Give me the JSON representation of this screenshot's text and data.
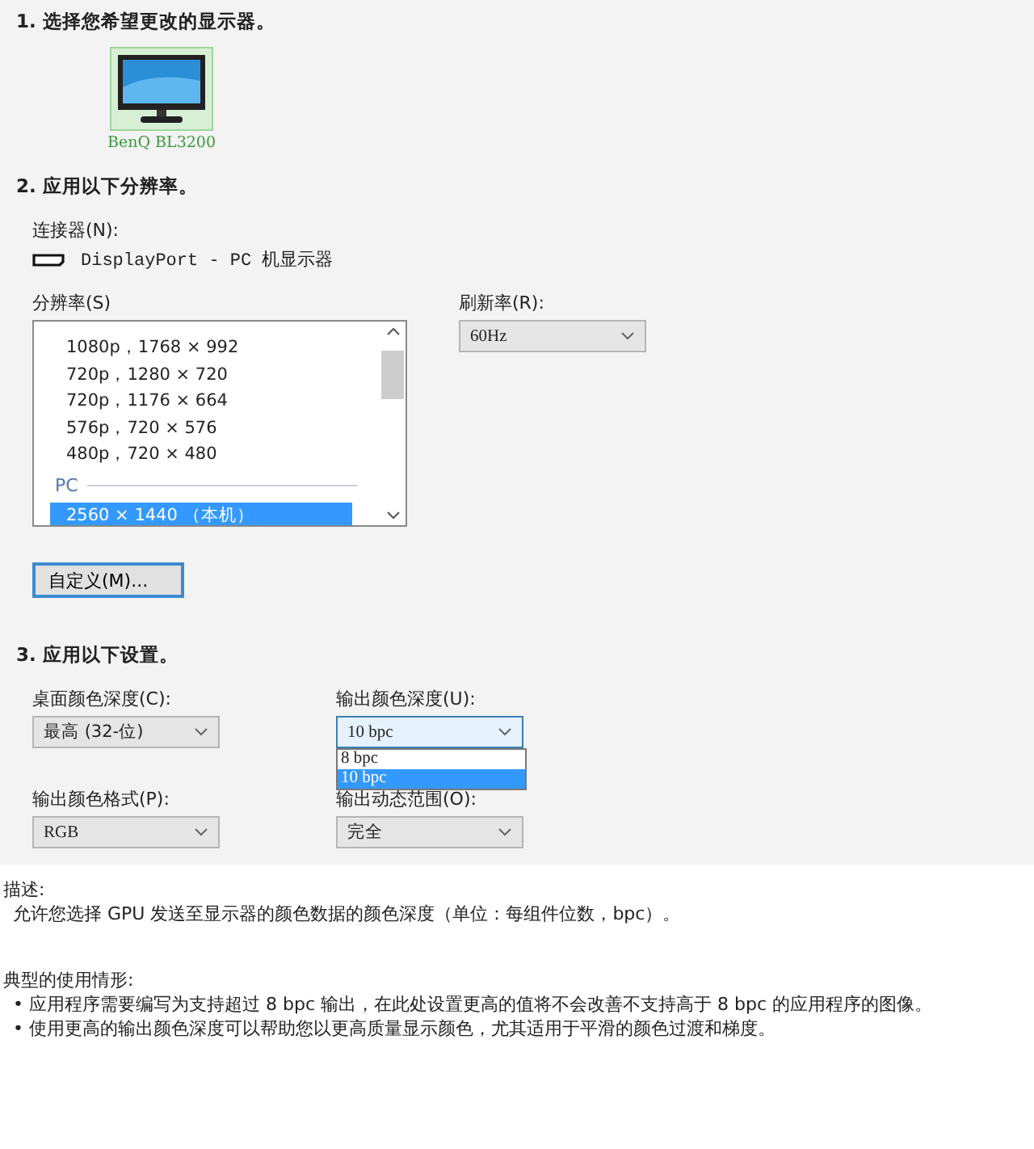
{
  "section_1": {
    "title": "1. 选择您希望更改的显示器。",
    "monitors": [
      {
        "name": "BenQ BL3200",
        "selected": true
      }
    ]
  },
  "section_2": {
    "title": "2. 应用以下分辨率。",
    "connector_label": "连接器(N):",
    "connector": "DisplayPort - PC 机显示器",
    "resolution_label": "分辨率(S)",
    "resolutions": [
      {
        "kind": "item",
        "label": "1080p，1768 × 992",
        "selected": false
      },
      {
        "kind": "item",
        "label": "720p，1280 × 720",
        "selected": false
      },
      {
        "kind": "item",
        "label": "720p，1176 × 664",
        "selected": false
      },
      {
        "kind": "item",
        "label": "576p，720 × 576",
        "selected": false
      },
      {
        "kind": "item",
        "label": "480p，720 × 480",
        "selected": false
      },
      {
        "kind": "header",
        "label": "PC"
      },
      {
        "kind": "item",
        "label": "2560 × 1440 （本机）",
        "selected": true
      }
    ],
    "refresh_label": "刷新率(R):",
    "refresh_value": "60Hz",
    "custom_button": "自定义(M)..."
  },
  "section_3": {
    "title": "3. 应用以下设置。",
    "fields": [
      {
        "label": "桌面颜色深度(C):",
        "value": "最高 (32-位)",
        "expanded": false
      },
      {
        "label": "输出颜色深度(U):",
        "value": "10 bpc",
        "expanded": true,
        "options": [
          {
            "label": "8 bpc",
            "selected": false
          },
          {
            "label": "10 bpc",
            "selected": true
          }
        ]
      },
      {
        "label": "输出颜色格式(P):",
        "value": "RGB",
        "expanded": false
      },
      {
        "label": "输出动态范围(O):",
        "value": "完全",
        "expanded": false
      }
    ]
  },
  "description": {
    "label": "描述:",
    "text": "允许您选择 GPU 发送至显示器的颜色数据的颜色深度（单位：每组件位数，bpc）。"
  },
  "usage": {
    "label": "典型的使用情形:",
    "bullets": [
      "• 应用程序需要编写为支持超过 8 bpc 输出，在此处设置更高的值将不会改善不支持高于 8 bpc 的应用程序的图像。",
      "• 使用更高的输出颜色深度可以帮助您以更高质量显示颜色，尤其适用于平滑的颜色过渡和梯度。"
    ]
  }
}
